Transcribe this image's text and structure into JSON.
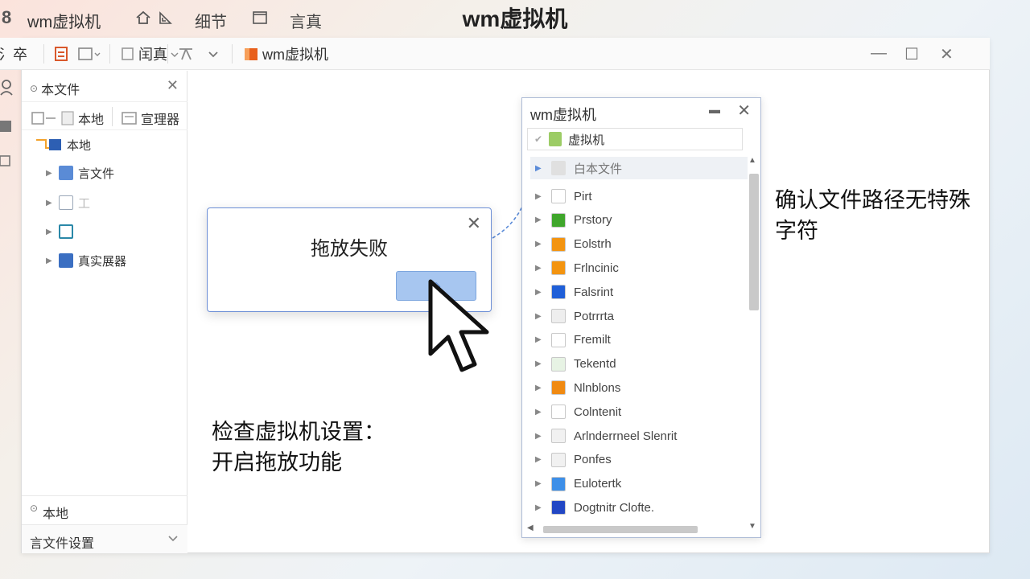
{
  "topbar": {
    "logo": "8",
    "app_title": "wm虚拟机",
    "menu_detail": "细节",
    "menu_view": "言真",
    "page_title": "wm虚拟机"
  },
  "toolbar": {
    "item1": "氵卒",
    "item2": "闰真",
    "window_title": "wm虚拟机"
  },
  "sidebar": {
    "header": "本文件",
    "tab_local": "本地",
    "tab_manager": "宣理器",
    "tree": [
      {
        "label": "本地",
        "icon_color": "#2d5fb3"
      },
      {
        "label": "言文件",
        "icon_color": "#5a8bd6"
      },
      {
        "label": "工",
        "icon_color": "#9aa7b8"
      },
      {
        "label": "",
        "icon_color": "#2a88a8"
      },
      {
        "label": "真实展器",
        "icon_color": "#3b6fc2"
      }
    ],
    "bottom_local": "本地",
    "bottom_settings": "言文件设置"
  },
  "dialog": {
    "message": "拖放失败",
    "ok_glyph": "◈"
  },
  "panel": {
    "title": "wm虚拟机",
    "path": "虚拟机",
    "selected": "白本文件",
    "items": [
      {
        "label": "Pirt",
        "icon": "#ffffff"
      },
      {
        "label": "Prstory",
        "icon": "#3fa62b"
      },
      {
        "label": "Eolstrh",
        "icon": "#f39410"
      },
      {
        "label": "Frlncinic",
        "icon": "#f39410"
      },
      {
        "label": "Falsrint",
        "icon": "#1f5fd8"
      },
      {
        "label": "Potrrrta",
        "icon": "#eeeeee"
      },
      {
        "label": "Fremilt",
        "icon": "#ffffff"
      },
      {
        "label": "Tekentd",
        "icon": "#e7f3e4"
      },
      {
        "label": "Nlnblons",
        "icon": "#f08a12"
      },
      {
        "label": "Colntenit",
        "icon": "#ffffff"
      },
      {
        "label": "Arlnderrneel Slenrit",
        "icon": "#f1f1f1"
      },
      {
        "label": "Ponfes",
        "icon": "#f1f1f1"
      },
      {
        "label": "Eulotertk",
        "icon": "#3d8fe8"
      },
      {
        "label": "Dogtnitr Clofte.",
        "icon": "#2247c4"
      }
    ]
  },
  "annotations": {
    "right_line1": "确认文件路径无特殊",
    "right_line2": "字符",
    "left_line1": "检查虚拟机设置：",
    "left_line2": "开启拖放功能"
  }
}
